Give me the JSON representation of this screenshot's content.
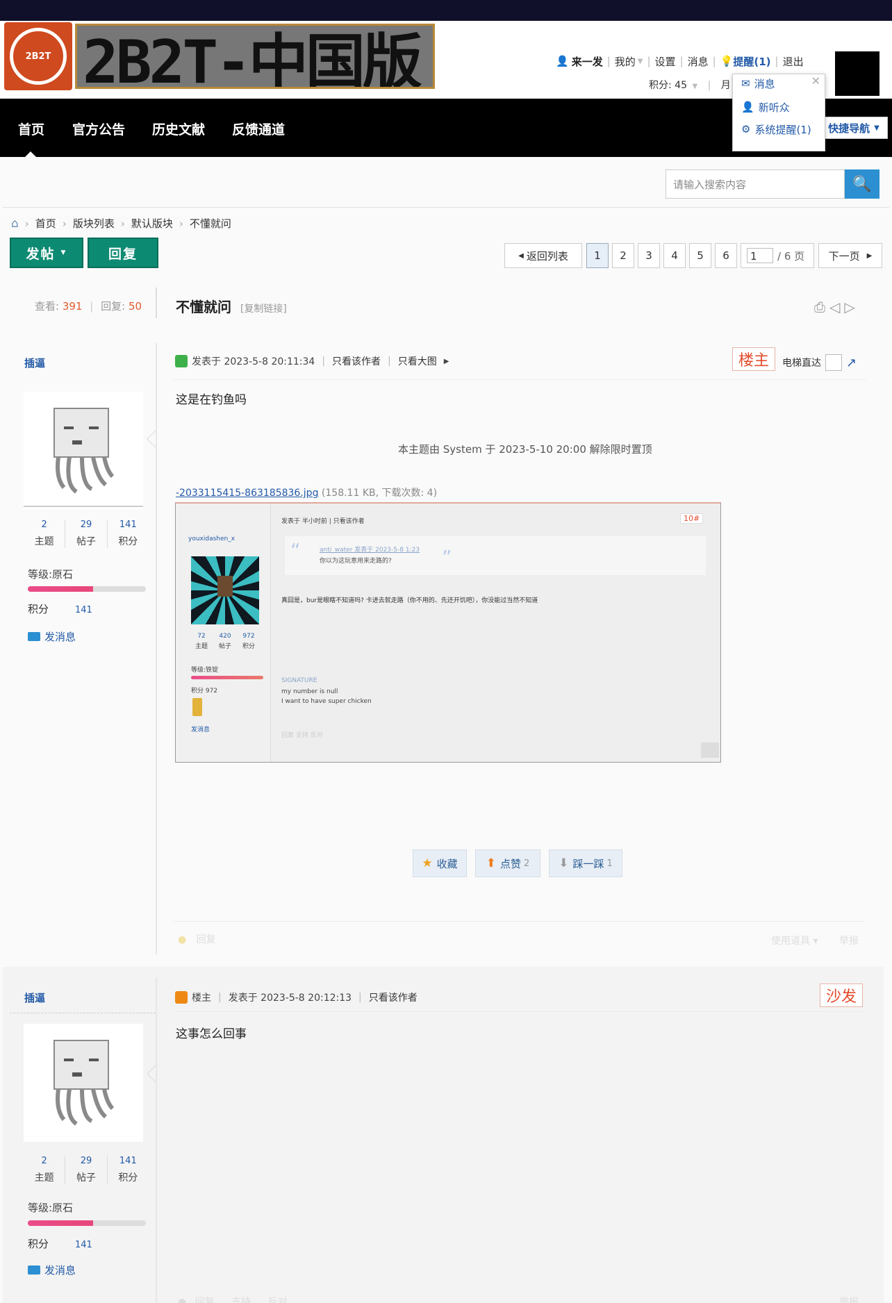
{
  "site": {
    "logo_mark": "2B2T",
    "logo_text": "2B2T-中国版"
  },
  "userbar": {
    "username": "来一发",
    "my": "我的",
    "settings": "设置",
    "messages": "消息",
    "reminders": "提醒(1)",
    "logout": "退出",
    "points": "积分: 45",
    "user_group_initial": "月"
  },
  "dropdown": {
    "items": [
      "消息",
      "新听众",
      "系统提醒(1)"
    ]
  },
  "nav": {
    "items": [
      "首页",
      "官方公告",
      "历史文献",
      "反馈通道"
    ],
    "quick_nav": "快捷导航"
  },
  "search": {
    "placeholder": "请输入搜索内容"
  },
  "breadcrumb": [
    "首页",
    "版块列表",
    "默认版块",
    "不懂就问"
  ],
  "actions": {
    "post": "发帖",
    "reply": "回复"
  },
  "pagination": {
    "back": "返回列表",
    "pages": [
      "1",
      "2",
      "3",
      "4",
      "5",
      "6"
    ],
    "current_input": "1",
    "total": "/ 6 页",
    "next": "下一页"
  },
  "thread": {
    "views_label": "查看:",
    "views": "391",
    "replies_label": "回复:",
    "replies": "50",
    "title": "不懂就问",
    "copy_link": "[复制链接]"
  },
  "post1": {
    "author": "插逼",
    "stats": [
      {
        "n": "2",
        "l": "主题"
      },
      {
        "n": "29",
        "l": "帖子"
      },
      {
        "n": "141",
        "l": "积分"
      }
    ],
    "level": "等级:原石",
    "level_fraction": 0.55,
    "score_label": "积分",
    "score_value": "141",
    "send_msg": "发消息",
    "meta_posted": "发表于 2023-5-8 20:11:34",
    "meta_only_author": "只看该作者",
    "meta_big_image": "只看大图",
    "floor": "楼主",
    "elevator": "电梯直达",
    "content": "这是在钓鱼吗",
    "notice": "本主题由 System 于 2023-5-10 20:00 解除限时置顶",
    "attachment_name": "-2033115415-863185836.jpg",
    "attachment_info": "(158.11 KB, 下载次数: 4)",
    "reactions": [
      {
        "label": "收藏",
        "count": ""
      },
      {
        "label": "点赞",
        "count": "2"
      },
      {
        "label": "踩一踩",
        "count": "1"
      }
    ],
    "footer_reply": "回复",
    "footer_tools": "使用道具",
    "footer_report": "举报"
  },
  "embedded_image": {
    "username": "youxidashen_x",
    "meta": "发表于 半小时前  |  只看该作者",
    "floor": "10#",
    "quote_line1": "anti_water 发表于 2023-5-8 1:23",
    "quote_line2": "你以为这玩意用来走路的?",
    "body": "真囧是，bur是眼瞎不知道吗? 卡进去就走路（你不用的、先还开饥吧），你没能过当然不知道",
    "stats": [
      "72",
      "420",
      "972"
    ],
    "stat_labels": [
      "主题",
      "帖子",
      "积分"
    ],
    "level": "等级:铁锭",
    "score": "积分    972",
    "send_msg": "发消息",
    "sig_label": "SIGNATURE",
    "sig1": "my number is null",
    "sig2": "I want to have super chicken",
    "footer": "回复   支持   反对"
  },
  "post2": {
    "author": "插逼",
    "stats": [
      {
        "n": "2",
        "l": "主题"
      },
      {
        "n": "29",
        "l": "帖子"
      },
      {
        "n": "141",
        "l": "积分"
      }
    ],
    "level": "等级:原石",
    "level_fraction": 0.55,
    "score_label": "积分",
    "score_value": "141",
    "send_msg": "发消息",
    "role": "楼主",
    "meta_posted": "发表于 2023-5-8 20:12:13",
    "meta_only_author": "只看该作者",
    "floor": "沙发",
    "content": "这事怎么回事",
    "footer_reply": "回复",
    "footer_support": "支持",
    "footer_oppose": "反对",
    "footer_report": "举报"
  },
  "colors": {
    "accent_blue": "#225aa8",
    "green_button": "#0d8a72",
    "floor_red": "#e34b2c",
    "search_blue": "#2b8fd1"
  }
}
